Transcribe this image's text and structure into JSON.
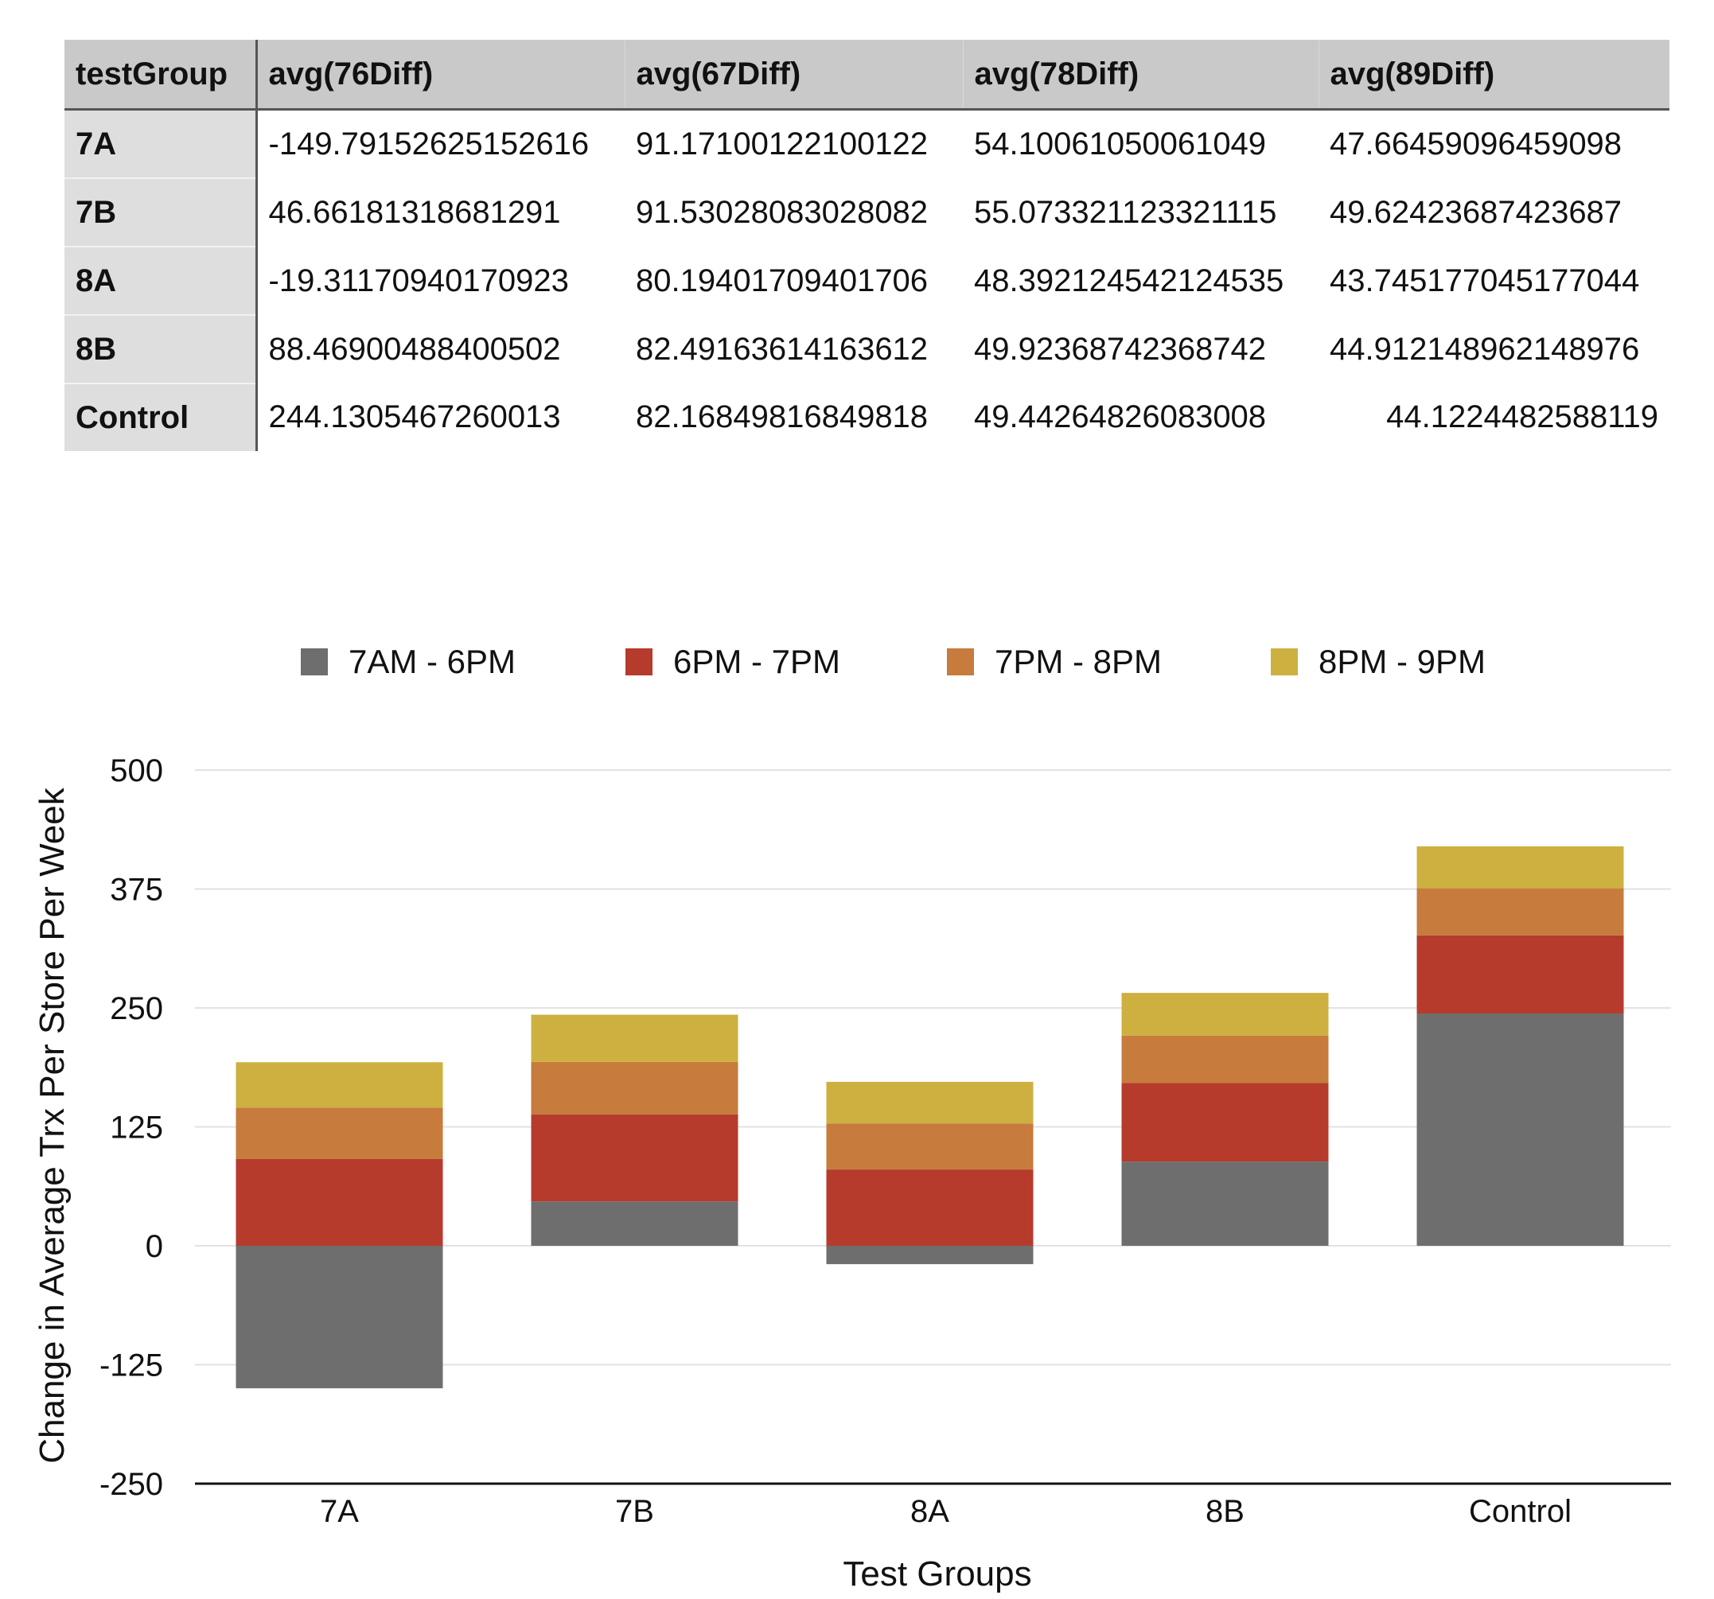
{
  "table": {
    "columns": [
      "testGroup",
      "avg(76Diff)",
      "avg(67Diff)",
      "avg(78Diff)",
      "avg(89Diff)"
    ],
    "rows": [
      {
        "group": "7A",
        "values": [
          "-149.79152625152616",
          "91.17100122100122",
          "54.10061050061049",
          "47.66459096459098"
        ]
      },
      {
        "group": "7B",
        "values": [
          "46.66181318681291",
          "91.53028083028082",
          "55.073321123321115",
          "49.62423687423687"
        ]
      },
      {
        "group": "8A",
        "values": [
          "-19.31170940170923",
          "80.19401709401706",
          "48.392124542124535",
          "43.745177045177044"
        ]
      },
      {
        "group": "8B",
        "values": [
          "88.46900488400502",
          "82.49163614163612",
          "49.92368742368742",
          "44.912148962148976"
        ]
      },
      {
        "group": "Control",
        "values": [
          "244.1305467260013",
          "82.16849816849818",
          "49.44264826083008",
          "44.1224482588119"
        ]
      }
    ]
  },
  "chart_data": {
    "type": "bar",
    "stacked": true,
    "categories": [
      "7A",
      "7B",
      "8A",
      "8B",
      "Control"
    ],
    "series": [
      {
        "name": "7AM - 6PM",
        "color": "#6e6e6e",
        "values": [
          -149.79,
          46.66,
          -19.31,
          88.47,
          244.13
        ]
      },
      {
        "name": "6PM - 7PM",
        "color": "#b63b2c",
        "values": [
          91.17,
          91.53,
          80.19,
          82.49,
          82.17
        ]
      },
      {
        "name": "7PM - 8PM",
        "color": "#c77b3c",
        "values": [
          54.1,
          55.07,
          48.39,
          49.92,
          49.44
        ]
      },
      {
        "name": "8PM - 9PM",
        "color": "#cdb040",
        "values": [
          47.66,
          49.62,
          43.75,
          44.91,
          44.12
        ]
      }
    ],
    "xlabel": "Test Groups",
    "ylabel": "Change in Average Trx Per Store Per Week",
    "ylim": [
      -250,
      500
    ],
    "yticks": [
      500,
      375,
      250,
      125,
      0,
      -125,
      -250
    ],
    "legend_position": "top",
    "grid": true
  }
}
